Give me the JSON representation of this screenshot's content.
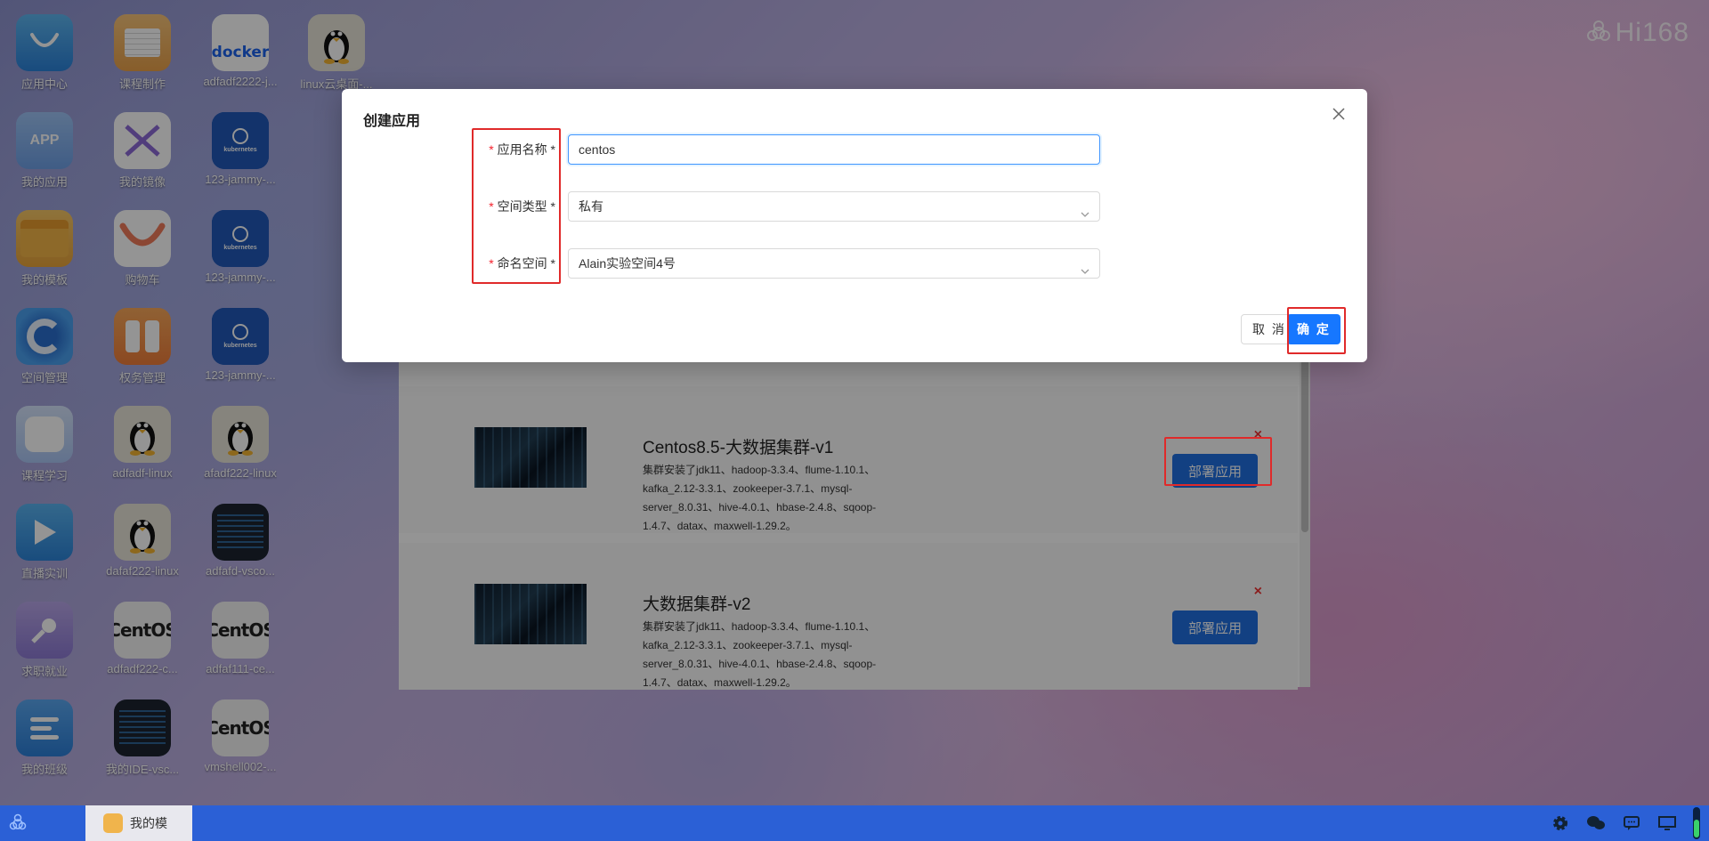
{
  "watermark": "Hi168",
  "desktop_icons": [
    {
      "label": "应用中心",
      "icon": "app-center-icon"
    },
    {
      "label": "课程制作",
      "icon": "course-making-icon"
    },
    {
      "label": "adfadf2222-j...",
      "icon": "docker-icon",
      "text": "docker"
    },
    {
      "label": "linux云桌面-...",
      "icon": "linux-penguin-icon"
    },
    {
      "label": "我的应用",
      "icon": "my-apps-icon",
      "text": "APP"
    },
    {
      "label": "我的镜像",
      "icon": "my-images-icon"
    },
    {
      "label": "123-jammy-...",
      "icon": "kubernetes-icon",
      "text": "kubernetes"
    },
    {
      "label": "我的模板",
      "icon": "folder-icon"
    },
    {
      "label": "购物车",
      "icon": "shopping-cart-icon"
    },
    {
      "label": "123-jammy-...",
      "icon": "kubernetes-icon",
      "text": "kubernetes"
    },
    {
      "label": "空间管理",
      "icon": "space-management-icon"
    },
    {
      "label": "权务管理",
      "icon": "task-management-icon"
    },
    {
      "label": "123-jammy-...",
      "icon": "kubernetes-icon",
      "text": "kubernetes"
    },
    {
      "label": "课程学习",
      "icon": "course-learning-icon"
    },
    {
      "label": "adfadf-linux",
      "icon": "linux-penguin-icon"
    },
    {
      "label": "afadf222-linux",
      "icon": "linux-penguin-icon"
    },
    {
      "label": "直播实训",
      "icon": "live-training-icon"
    },
    {
      "label": "dafaf222-linux",
      "icon": "linux-penguin-icon"
    },
    {
      "label": "adfafd-vsco...",
      "icon": "vscode-terminal-icon"
    },
    {
      "label": "求职就业",
      "icon": "job-search-icon"
    },
    {
      "label": "adfadf222-c...",
      "icon": "centos-icon",
      "text": "CentOS"
    },
    {
      "label": "adfaf111-ce...",
      "icon": "centos-icon",
      "text": "CentOS"
    },
    {
      "label": "我的班级",
      "icon": "my-class-icon"
    },
    {
      "label": "我的IDE-vsc...",
      "icon": "ide-terminal-icon"
    },
    {
      "label": "vmshell002-...",
      "icon": "centos-icon",
      "text": "CentOS"
    }
  ],
  "template_list": [
    {
      "title": "Centos8.5-大数据集群-v1",
      "description": "集群安装了jdk11、hadoop-3.3.4、flume-1.10.1、kafka_2.12-3.3.1、zookeeper-3.7.1、mysql-server_8.0.31、hive-4.0.1、hbase-2.4.8、sqoop-1.4.7、datax、maxwell-1.29.2。",
      "deploy_label": "部署应用",
      "close_label": "×"
    },
    {
      "title": "大数据集群-v2",
      "description": "集群安装了jdk11、hadoop-3.3.4、flume-1.10.1、kafka_2.12-3.3.1、zookeeper-3.7.1、mysql-server_8.0.31、hive-4.0.1、hbase-2.4.8、sqoop-1.4.7、datax、maxwell-1.29.2。",
      "deploy_label": "部署应用",
      "close_label": "×"
    }
  ],
  "modal": {
    "title": "创建应用",
    "fields": [
      {
        "label": "应用名称 *",
        "value": "centos",
        "type": "text"
      },
      {
        "label": "空间类型 *",
        "value": "私有",
        "type": "select"
      },
      {
        "label": "命名空间 *",
        "value": "Alain实验空间4号",
        "type": "select"
      }
    ],
    "cancel_label": "取 消",
    "ok_label": "确 定"
  },
  "taskbar": {
    "task_label": "我的模",
    "tray_icons": [
      "gear-icon",
      "wechat-icon",
      "chat-icon",
      "monitor-icon",
      "volume-icon"
    ]
  },
  "colors": {
    "primary": "#1677ff",
    "deploy_button": "#1f6fe0",
    "taskbar": "#2b60d6",
    "annotation_red": "#e02a2a",
    "required_star": "#f5222d"
  }
}
